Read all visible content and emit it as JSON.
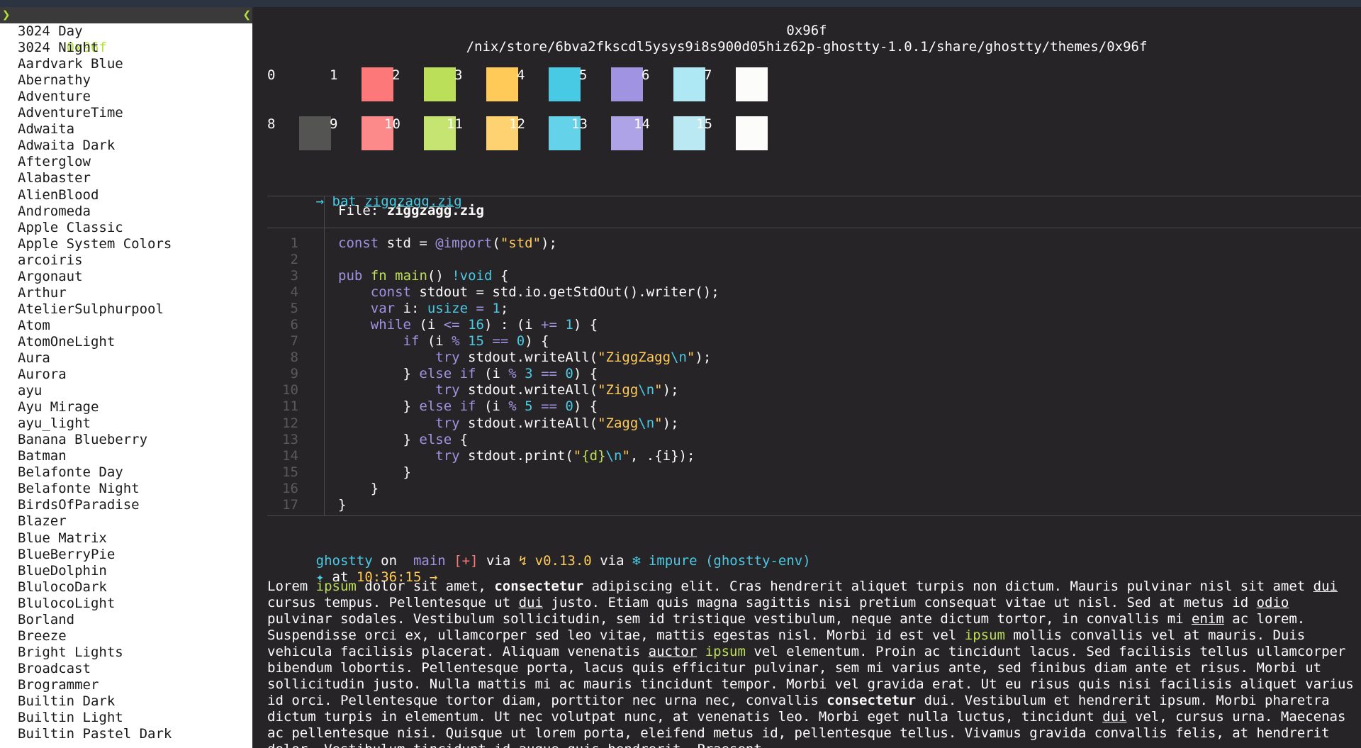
{
  "sidebar": {
    "selected": "0x96f",
    "themes": [
      "3024 Day",
      "3024 Night",
      "Aardvark Blue",
      "Abernathy",
      "Adventure",
      "AdventureTime",
      "Adwaita",
      "Adwaita Dark",
      "Afterglow",
      "Alabaster",
      "AlienBlood",
      "Andromeda",
      "Apple Classic",
      "Apple System Colors",
      "arcoiris",
      "Argonaut",
      "Arthur",
      "AtelierSulphurpool",
      "Atom",
      "AtomOneLight",
      "Aura",
      "Aurora",
      "ayu",
      "Ayu Mirage",
      "ayu_light",
      "Banana Blueberry",
      "Batman",
      "Belafonte Day",
      "Belafonte Night",
      "BirdsOfParadise",
      "Blazer",
      "Blue Matrix",
      "BlueBerryPie",
      "BlueDolphin",
      "BlulocoDark",
      "BlulocoLight",
      "Borland",
      "Breeze",
      "Bright Lights",
      "Broadcast",
      "Brogrammer",
      "Builtin Dark",
      "Builtin Light",
      "Builtin Pastel Dark"
    ]
  },
  "header": {
    "title": "0x96f",
    "path": "/nix/store/6bva2fkscdl5ysys9i8s900d05hiz62p-ghostty-1.0.1/share/ghostty/themes/0x96f"
  },
  "palette": [
    {
      "n": "0",
      "color": "#262427"
    },
    {
      "n": "1",
      "color": "#fc7879"
    },
    {
      "n": "2",
      "color": "#bcdf59"
    },
    {
      "n": "3",
      "color": "#ffca58"
    },
    {
      "n": "4",
      "color": "#49cae4"
    },
    {
      "n": "5",
      "color": "#a093e2"
    },
    {
      "n": "6",
      "color": "#aee8f4"
    },
    {
      "n": "7",
      "color": "#fcfcfa"
    },
    {
      "n": "8",
      "color": "#545452"
    },
    {
      "n": "9",
      "color": "#fc8a8b"
    },
    {
      "n": "10",
      "color": "#c6e472"
    },
    {
      "n": "11",
      "color": "#ffd271"
    },
    {
      "n": "12",
      "color": "#64d2e8"
    },
    {
      "n": "13",
      "color": "#aea3e6"
    },
    {
      "n": "14",
      "color": "#bae9f4"
    },
    {
      "n": "15",
      "color": "#fcfcfa"
    }
  ],
  "command": {
    "arrow": "→",
    "cmd": "bat",
    "arg": "ziggzagg.zig"
  },
  "bat": {
    "file_label": "File:",
    "file_name": "ziggzagg.zig",
    "lines": [
      "1",
      "2",
      "3",
      "4",
      "5",
      "6",
      "7",
      "8",
      "9",
      "10",
      "11",
      "12",
      "13",
      "14",
      "15",
      "16",
      "17"
    ]
  },
  "prompt": {
    "dir": "ghostty",
    "on": "on",
    "branch_icon": "",
    "branch": "main",
    "status": "[+]",
    "via": "via",
    "zig_icon": "↯",
    "zig_version": "v0.13.0",
    "via2": "via",
    "nix_icon": "❄",
    "env": "impure (ghostty-env)",
    "star": "✦",
    "at": "at",
    "time": "10:36:15",
    "arrow": "→"
  },
  "lorem": {
    "text": [
      "Lorem ",
      "ipsum",
      " dolor sit amet, ",
      "consectetur",
      " adipiscing elit. Cras hendrerit aliquet turpis non dictum. Mauris pulvinar nisl sit amet ",
      "dui",
      " cursus tempus. Pellentesque ut ",
      "dui",
      " justo. Etiam quis magna sagittis nisi pretium consequat vitae ut nisl. Sed at metus id ",
      "odio",
      " pulvinar sodales. Vestibulum sollicitudin, sem id tristique vestibulum, neque ante dictum tortor, in convallis mi ",
      "enim",
      " ac lorem. Suspendisse orci ex, ullamcorper sed leo vitae, mattis egestas nisl. Morbi id est vel ",
      "ipsum",
      " mollis convallis vel at mauris. Duis vehicula facilisis placerat. Aliquam venenatis ",
      "auctor",
      " ",
      "ipsum",
      " vel elementum. Proin ac tincidunt lacus. Sed facilisis tellus ullamcorper bibendum lobortis. Pellentesque porta, lacus quis efficitur pulvinar, sem mi varius ante, sed finibus diam ante et risus.  Morbi ut sollicitudin justo. Nulla mattis mi ac mauris tincidunt tempor. Morbi vel gravida erat. Ut eu risus quis nisi facilisis aliquet varius id orci. Pellentesque tortor diam, porttitor nec urna nec, convallis ",
      "consectetur",
      " dui. Vestibulum et hendrerit ipsum. Morbi pharetra dictum turpis in elementum. Ut nec volutpat nunc, at venenatis leo. Morbi eget nulla luctus, tincidunt ",
      "dui",
      " vel, cursus urna. Maecenas ac pellentesque nisi. Quisque ut lorem porta, eleifend metus id, pellentesque tellus.  Vivamus gravida convallis felis, at hendrerit dolor. Vestibulum tincidunt id augue quis hendrerit. Praesent"
    ]
  }
}
